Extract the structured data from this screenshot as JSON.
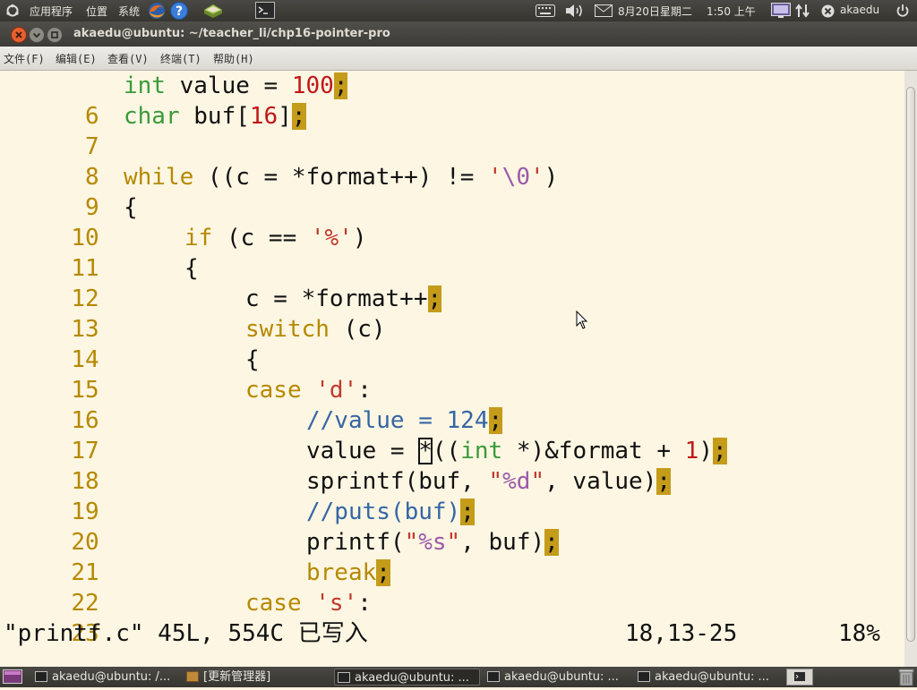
{
  "top_panel": {
    "applications": "应用程序",
    "places": "位置",
    "system": "系统",
    "datetime_date": "8月20日星期二",
    "datetime_time": "1:50 上午",
    "user": "akaedu"
  },
  "window": {
    "title": "akaedu@ubuntu: ~/teacher_li/chp16-pointer-pro"
  },
  "menu": {
    "file": "文件(F)",
    "edit": "编辑(E)",
    "view": "查看(V)",
    "terminal": "终端(T)",
    "help": "帮助(H)"
  },
  "editor": {
    "line_numbers": [
      "6",
      "7",
      "8",
      "9",
      "10",
      "11",
      "12",
      "13",
      "14",
      "15",
      "16",
      "17",
      "18",
      "19",
      "20",
      "21",
      "22",
      "23"
    ],
    "code": {
      "l6_kw": "int",
      "l6_a": " value = ",
      "l6_num": "100",
      "l7_kw": "char",
      "l7_a": " buf[",
      "l7_num": "16",
      "l7_b": "]",
      "l9_kw": "while",
      "l9_a": " ((c = *format++) != ",
      "l9_q1": "'",
      "l9_esc": "\\0",
      "l9_q2": "'",
      "l9_b": ")",
      "l10": "{",
      "l11_kw": "if",
      "l11_a": " (c == ",
      "l11_str": "'%'",
      "l11_b": ")",
      "l12": "{",
      "l13_a": "c = *format++",
      "l14_kw": "switch",
      "l14_a": " (c)",
      "l15": "{",
      "l16_kw": "case",
      "l16_sp": " ",
      "l16_str": "'d'",
      "l16_b": ":",
      "l17_cm": "//value = 124",
      "l18_a": "value = ",
      "l18_cur": "*",
      "l18_b": "((",
      "l18_ty": "int",
      "l18_c": " *)&format + ",
      "l18_num": "1",
      "l18_d": ")",
      "l19_a": "sprintf(buf, ",
      "l19_q1": "\"",
      "l19_esc": "%d",
      "l19_q2": "\"",
      "l19_b": ", value)",
      "l20_cm": "//puts(buf)",
      "l21_a": "printf(",
      "l21_q1": "\"",
      "l21_esc": "%s",
      "l21_q2": "\"",
      "l21_b": ", buf)",
      "l22_kw": "break",
      "l23_kw": "case",
      "l23_sp": " ",
      "l23_str": "'s'",
      "l23_b": ":",
      "semicolon": ";"
    },
    "status_left": "\"printf.c\" 45L, 554C 已写入",
    "status_position": "18,13-25",
    "status_percent": "18%"
  },
  "taskbar": {
    "items": [
      "akaedu@ubuntu: /...",
      "[更新管理器]",
      "akaedu@ubuntu: ...",
      "akaedu@ubuntu: ...",
      "akaedu@ubuntu: ..."
    ]
  },
  "colors": {
    "editor_bg": "#fdf6e3",
    "keyword": "#b58900",
    "type": "#3a9a3a",
    "number": "#c01818",
    "comment": "#3465a4",
    "semicolon_highlight": "#c59b1a"
  }
}
